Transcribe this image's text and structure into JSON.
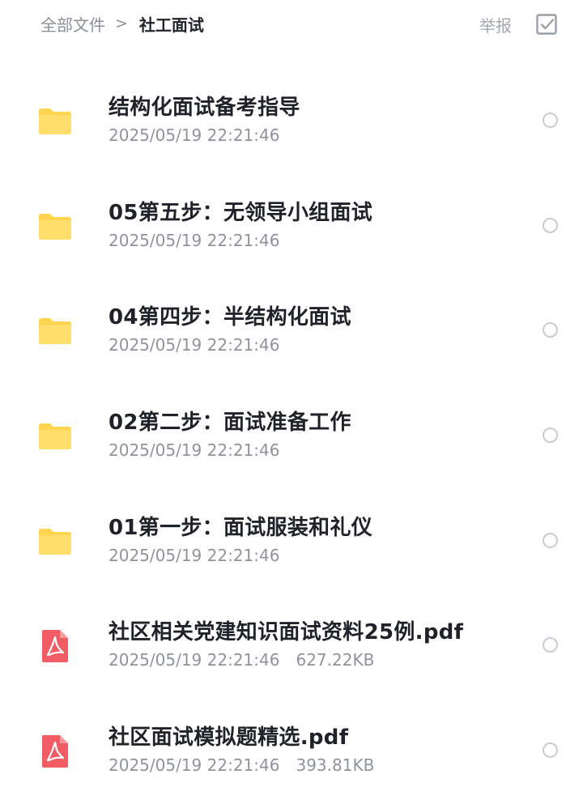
{
  "breadcrumb": {
    "root": "全部文件",
    "separator": ">",
    "current": "社工面试"
  },
  "actions": {
    "report_label": "举报",
    "multiselect_icon": "check-square-icon"
  },
  "colors": {
    "folder": "#ffd54f",
    "pdf": "#f25d65",
    "text_primary": "#1f2329",
    "text_secondary": "#8f949c"
  },
  "files": [
    {
      "type": "folder",
      "icon": "folder-icon",
      "name": "结构化面试备考指导",
      "date": "2025/05/19 22:21:46",
      "size": ""
    },
    {
      "type": "folder",
      "icon": "folder-icon",
      "name": "05第五步：无领导小组面试",
      "date": "2025/05/19 22:21:46",
      "size": ""
    },
    {
      "type": "folder",
      "icon": "folder-icon",
      "name": "04第四步：半结构化面试",
      "date": "2025/05/19 22:21:46",
      "size": ""
    },
    {
      "type": "folder",
      "icon": "folder-icon",
      "name": "02第二步：面试准备工作",
      "date": "2025/05/19 22:21:46",
      "size": ""
    },
    {
      "type": "folder",
      "icon": "folder-icon",
      "name": "01第一步：面试服装和礼仪",
      "date": "2025/05/19 22:21:46",
      "size": ""
    },
    {
      "type": "pdf",
      "icon": "pdf-icon",
      "name": "社区相关党建知识面试资料25例.pdf",
      "date": "2025/05/19 22:21:46",
      "size": "627.22KB"
    },
    {
      "type": "pdf",
      "icon": "pdf-icon",
      "name": "社区面试模拟题精选.pdf",
      "date": "2025/05/19 22:21:46",
      "size": "393.81KB"
    }
  ]
}
